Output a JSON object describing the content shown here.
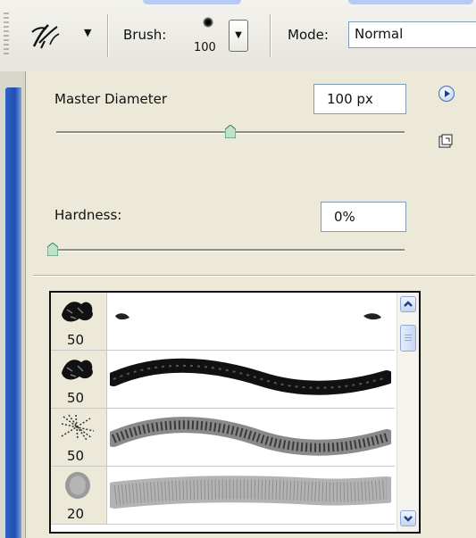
{
  "toolbar": {
    "brush_label": "Brush:",
    "brush_size": "100",
    "mode_label": "Mode:",
    "mode_value": "Normal",
    "tool_icon": "brush-tool-icon",
    "arrow_icon": "chevron-down-icon"
  },
  "panel": {
    "master_diameter_label": "Master Diameter",
    "master_diameter_value": "100 px",
    "master_diameter_slider_fraction": 0.5,
    "hardness_label": "Hardness:",
    "hardness_value": "0%",
    "hardness_slider_fraction": 0.0,
    "menu_icon": "panel-menu-arrow-icon",
    "new_preset_icon": "new-preset-icon"
  },
  "brush_list": {
    "items": [
      {
        "size": "50"
      },
      {
        "size": "50"
      },
      {
        "size": "50"
      },
      {
        "size": "20"
      }
    ]
  },
  "colors": {
    "toolbar_bg": "#f4f3ee",
    "panel_bg": "#ece9d8",
    "accent_blue": "#2e62c7",
    "field_border": "#7f9db9"
  }
}
